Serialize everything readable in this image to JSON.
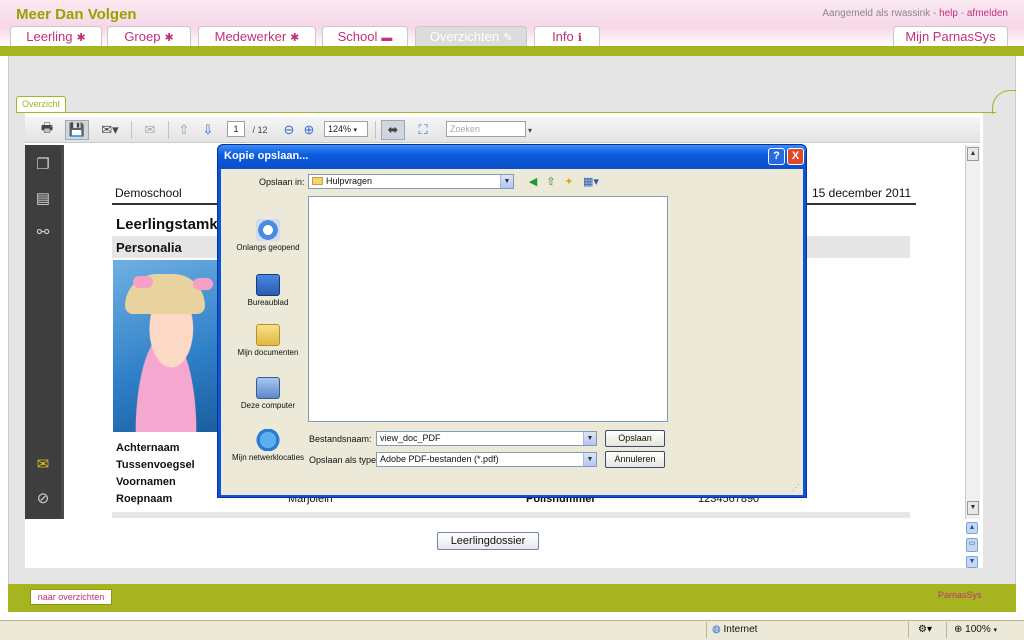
{
  "app": {
    "brand": "Meer Dan Volgen",
    "user_prefix": "Aangemeld als rwassink - ",
    "help": "help",
    "separator": " - ",
    "logout": "afmelden"
  },
  "tabs": [
    {
      "label": "Leerling",
      "icon": "person-icon"
    },
    {
      "label": "Groep",
      "icon": "group-icon"
    },
    {
      "label": "Medewerker",
      "icon": "person-icon"
    },
    {
      "label": "School",
      "icon": "school-icon"
    },
    {
      "label": "Overzichten",
      "icon": "pencil-icon"
    },
    {
      "label": "Info",
      "icon": "info-icon"
    },
    {
      "label": "Mijn ParnasSys",
      "icon": ""
    }
  ],
  "overview_tab": "Overzicht",
  "viewer": {
    "page_current": "1",
    "page_total": "/ 12",
    "zoom": "124%",
    "search_placeholder": "Zoeken"
  },
  "document": {
    "school": "Demoschool",
    "date": "15 december 2011",
    "title": "Leerlingstamk",
    "section": "Personalia",
    "fields": [
      {
        "label": "Achternaam",
        "value": ""
      },
      {
        "label": "Tussenvoegsel",
        "value": ""
      },
      {
        "label": "Voornamen",
        "value": ""
      },
      {
        "label": "Roepnaam",
        "value": "Marjolein"
      }
    ],
    "policy_label": "Polisnummer",
    "policy_value": "1234567890",
    "dossier_button": "Leerlingdossier"
  },
  "footer": {
    "back_button": "naar overzichten",
    "logo_text": "ParnasSys"
  },
  "statusbar": {
    "zone": "Internet",
    "zoom": "100%"
  },
  "dialog": {
    "title": "Kopie opslaan...",
    "save_in_label": "Opslaan in:",
    "save_in_value": "Hulpvragen",
    "places": [
      {
        "label": "Onlangs geopend",
        "icon": "recent-icon"
      },
      {
        "label": "Bureaublad",
        "icon": "desktop-icon"
      },
      {
        "label": "Mijn documenten",
        "icon": "documents-icon"
      },
      {
        "label": "Deze computer",
        "icon": "computer-icon"
      },
      {
        "label": "Mijn netwerklocaties",
        "icon": "network-icon"
      }
    ],
    "filename_label": "Bestandsnaam:",
    "filename_value": "view_doc_PDF",
    "filetype_label": "Opslaan als type:",
    "filetype_value": "Adobe PDF-bestanden (*.pdf)",
    "save_button": "Opslaan",
    "cancel_button": "Annuleren",
    "help_button": "?",
    "close_button": "X"
  }
}
